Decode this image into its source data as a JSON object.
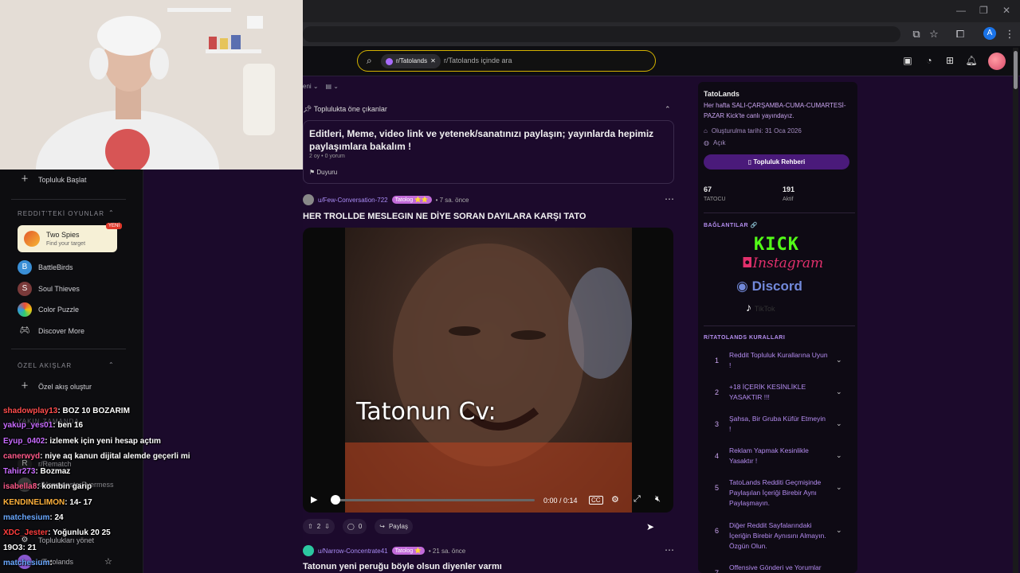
{
  "browser": {
    "window_controls": [
      "—",
      "❐",
      "✕"
    ],
    "profile_initial": "A"
  },
  "search": {
    "chip_label": "r/Tatolands",
    "placeholder": "r/Tatolands içinde ara"
  },
  "sidebar": {
    "start_community": "Topluluk Başlat",
    "games_section": "REDDIT'TEKİ OYUNLAR",
    "featured_game": {
      "title": "Two Spies",
      "subtitle": "Find your target",
      "badge": "YENİ"
    },
    "games": [
      "BattleBirds",
      "Soul Thieves",
      "Color Puzzle",
      "Discover More"
    ],
    "custom_feeds_section": "ÖZEL AKIŞLAR",
    "create_custom_feed": "Özel akış oluştur",
    "recent_section": "YAKIN ZAMANDA",
    "recent": [
      "r/Rematch",
      "r/NonmonsterEvermess"
    ],
    "manage_communities": "Toplulukları yönet",
    "joined": "r/Tatolands",
    "letter_r": "R"
  },
  "chat": [
    {
      "user": "shadowplay13",
      "text": "BOZ 10 BOZARIM",
      "color": "#ff4d4d"
    },
    {
      "user": "yakup_yes01",
      "text": "ben 16",
      "color": "#c86bff"
    },
    {
      "user": "Eyup_0402",
      "text": "izlemek için yeni hesap açtım",
      "color": "#c86bff"
    },
    {
      "user": "canerwyd",
      "text": "niye aq kanun dijital alemde geçerli mi",
      "color": "#ff5a8a"
    },
    {
      "user": "Tahir273",
      "text": "Bozmaz",
      "color": "#c86bff"
    },
    {
      "user": "isabella8",
      "text": "kombin garip",
      "color": "#ff5a8a"
    },
    {
      "user": "KENDINELIMON",
      "text": "14- 17",
      "color": "#ffb23d"
    },
    {
      "user": "matchesium",
      "text": "24",
      "color": "#6aa8ff"
    },
    {
      "user": "XDC_Jester",
      "text": "Yoğunluk 20 25",
      "color": "#ff3d3d"
    },
    {
      "user": "19O3",
      "text": "21",
      "color": "#ffffff"
    },
    {
      "user": "matchesium",
      "text": "",
      "color": "#6aa8ff"
    }
  ],
  "feed": {
    "sort_label": "eni",
    "highlights_header": "Toplulukta öne çıkanlar",
    "highlight_card": {
      "title": "Editleri, Meme, video link ve yetenek/sanatınızı paylaşın; yayınlarda hepimiz paylaşımlara bakalım !",
      "meta": "2 oy • 0 yorum",
      "tag": "Duyuru"
    },
    "post1": {
      "user": "u/Few-Conversation-722",
      "flair": "Tatolog ⭐⭐",
      "time": "• 7 sa. önce",
      "title": "HER TROLLDE MESLEGIN NE DİYE SORAN DAYILARA KARŞI TATO",
      "video_caption": "Tatonun Cv:",
      "time_display": "0:00 / 0:14",
      "progress": 0.0,
      "votes": "2",
      "comments": "0",
      "share": "Paylaş"
    },
    "post2": {
      "user": "u/Narrow-Concentrate41",
      "flair": "Tatolog ⭐",
      "time": "• 21 sa. önce",
      "title": "Tatonun yeni peruğu böyle olsun diyenler varmı"
    }
  },
  "community": {
    "name": "TatoLands",
    "description": "Her hafta SALI-ÇARŞAMBA-CUMA-CUMARTESİ-PAZAR Kick'te canlı yayındayız.",
    "created": "Oluşturulma tarihi: 31 Oca 2026",
    "visibility": "Açık",
    "guide_button": "Topluluk Rehberi",
    "members": "67",
    "members_label": "TATOCU",
    "online": "191",
    "online_label": "Aktif",
    "links_header": "BAĞLANTILAR 🔗",
    "links": [
      "KICK",
      "Instagram",
      "Discord",
      "TikTok"
    ],
    "rules_header": "R/TATOLANDS KURALLARI",
    "rules": [
      {
        "n": "1",
        "text": "Reddit Topluluk Kurallarına Uyun !"
      },
      {
        "n": "2",
        "text": "+18 İÇERİK KESİNLİKLE YASAKTIR !!!"
      },
      {
        "n": "3",
        "text": "Şahsa, Bir Gruba Küfür Etmeyin !"
      },
      {
        "n": "4",
        "text": "Reklam Yapmak Kesinlikle Yasaktır !"
      },
      {
        "n": "5",
        "text": "TatoLands Redditi Geçmişinde Paylaşılan İçeriği Birebir Aynı Paylaşmayın."
      },
      {
        "n": "6",
        "text": "Diğer Reddit Sayfalarındaki İçeriğin Birebir Aynısını Almayın. Özgün Olun."
      },
      {
        "n": "7",
        "text": "Offensive Gönderi ve Yorumlar"
      }
    ]
  }
}
